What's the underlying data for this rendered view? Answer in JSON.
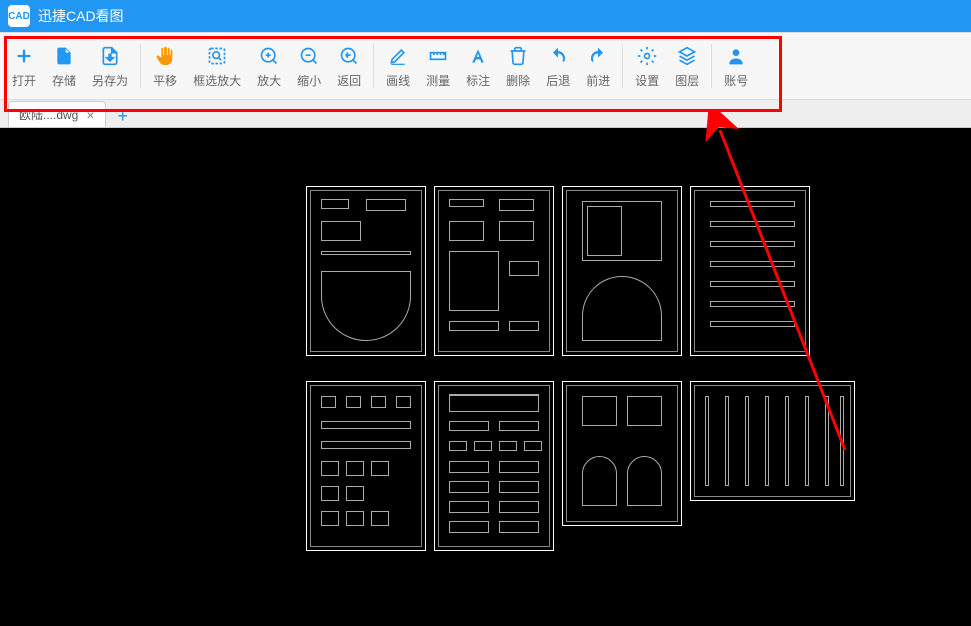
{
  "app": {
    "name": "CAD",
    "title": "迅捷CAD看图"
  },
  "toolbar": {
    "open": "打开",
    "save": "存储",
    "saveas": "另存为",
    "pan": "平移",
    "zoomwin": "框选放大",
    "zoomin": "放大",
    "zoomout": "缩小",
    "back": "返回",
    "drawline": "画线",
    "measure": "测量",
    "annotate": "标注",
    "delete": "删除",
    "undo": "后退",
    "redo": "前进",
    "settings": "设置",
    "layers": "图层",
    "account": "账号"
  },
  "tabs": {
    "file": "欧陆....dwg"
  }
}
